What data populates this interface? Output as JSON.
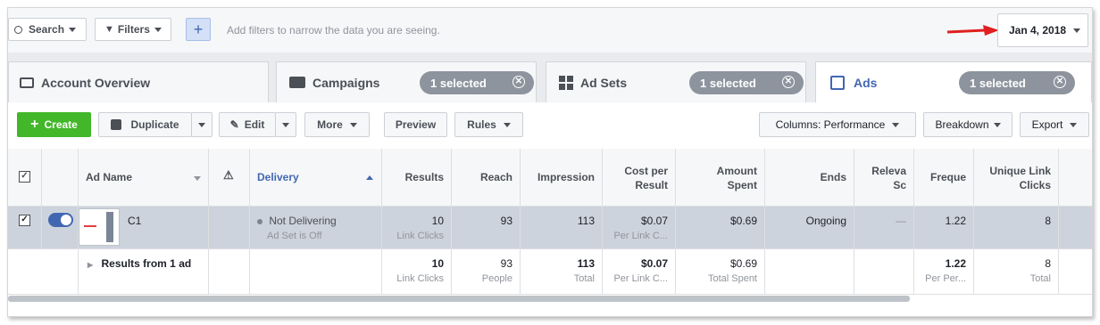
{
  "filterbar": {
    "search_label": "Search",
    "filters_label": "Filters",
    "add_label": "+",
    "hint": "Add filters to narrow the data you are seeing.",
    "date": "Jan 4, 2018"
  },
  "tabs": {
    "account_overview": "Account Overview",
    "campaigns": "Campaigns",
    "campaigns_selected": "1 selected",
    "ad_sets": "Ad Sets",
    "ad_sets_selected": "1 selected",
    "ads": "Ads",
    "ads_selected": "1 selected"
  },
  "toolbar": {
    "create": "Create",
    "duplicate": "Duplicate",
    "edit": "Edit",
    "more": "More",
    "preview": "Preview",
    "rules": "Rules",
    "columns": "Columns: Performance",
    "breakdown": "Breakdown",
    "export": "Export"
  },
  "table": {
    "headers": {
      "ad_name": "Ad Name",
      "delivery": "Delivery",
      "results": "Results",
      "reach": "Reach",
      "impression": "Impression",
      "cost_per_result_1": "Cost per",
      "cost_per_result_2": "Result",
      "amount_spent_1": "Amount",
      "amount_spent_2": "Spent",
      "ends": "Ends",
      "relevance_1": "Releva",
      "relevance_2": "Sc",
      "frequency": "Freque",
      "unique_link_clicks_1": "Unique Link",
      "unique_link_clicks_2": "Clicks"
    },
    "row": {
      "name": "C1",
      "delivery": "Not Delivering",
      "delivery_sub": "Ad Set is Off",
      "results": "10",
      "results_sub": "Link Clicks",
      "reach": "93",
      "impression": "113",
      "cost": "$0.07",
      "cost_sub": "Per Link C...",
      "amount": "$0.69",
      "ends": "Ongoing",
      "relevance": "—",
      "frequency": "1.22",
      "unique_clicks": "8"
    },
    "summary": {
      "label": "Results from 1 ad",
      "results": "10",
      "results_sub": "Link Clicks",
      "reach": "93",
      "reach_sub": "People",
      "impression": "113",
      "impression_sub": "Total",
      "cost": "$0.07",
      "cost_sub": "Per Link C...",
      "amount": "$0.69",
      "amount_sub": "Total Spent",
      "frequency": "1.22",
      "frequency_sub": "Per Per...",
      "unique_clicks": "8",
      "unique_clicks_sub": "Total"
    }
  },
  "colors": {
    "accent": "#4267b2",
    "create_green": "#42b72a",
    "annotation_arrow": "#e02020"
  }
}
